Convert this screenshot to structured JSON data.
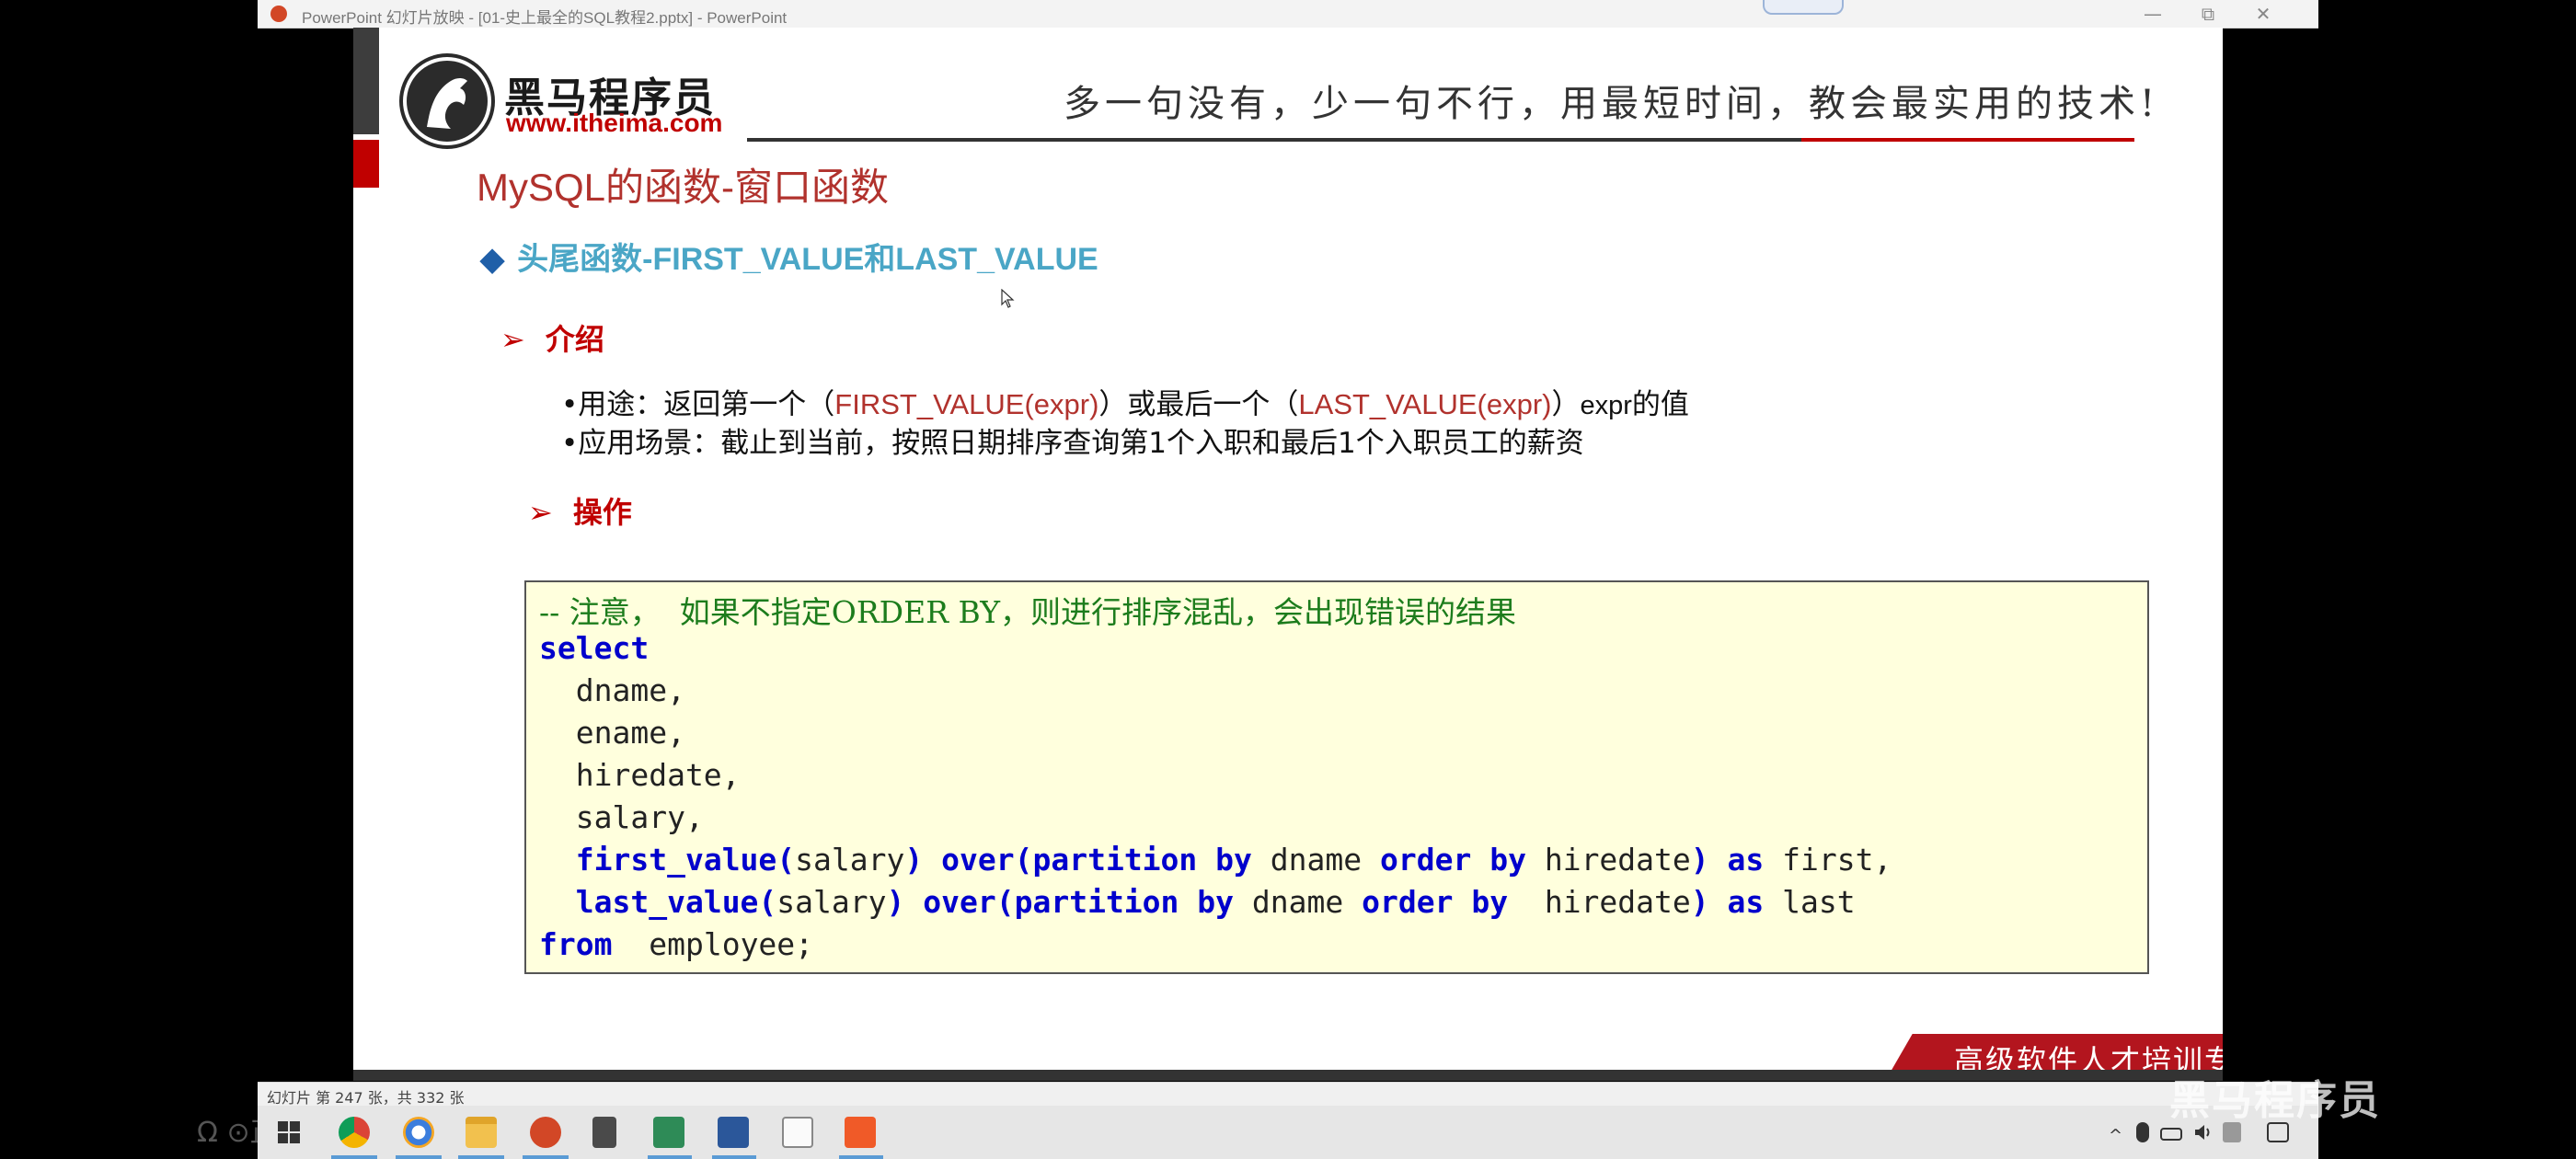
{
  "window": {
    "title": "PowerPoint 幻灯片放映 - [01-史上最全的SQL教程2.pptx] - PowerPoint",
    "controls": {
      "minimize": "—",
      "restore": "⧉",
      "close": "✕"
    }
  },
  "slide": {
    "logo_cn": "黑马程序员",
    "logo_url": "www.itheima.com",
    "slogan": "多一句没有，少一句不行，用最短时间，教会最实用的技术!",
    "title": "MySQL的函数-窗口函数",
    "subtitle": {
      "marker": "◆",
      "cn": "头尾函数",
      "en": "-FIRST_VALUE和LAST_VALUE"
    },
    "intro_label": "介绍",
    "bullet1": {
      "pre": "•用途：返回第一个（",
      "fn1": "FIRST_VALUE(expr)",
      "mid": "）或最后一个（",
      "fn2": "LAST_VALUE(expr)",
      "post1": "）",
      "post2": "expr",
      "post3": "的值"
    },
    "bullet2": "•应用场景：截止到当前，按照日期排序查询第1个入职和最后1个入职员工的薪资",
    "op_label": "操作",
    "code": {
      "comment": "-- 注意，  如果不指定ORDER BY，则进行排序混乱，会出现错误的结果",
      "select": "select",
      "cols": [
        "  dname,",
        "  ename,",
        "  hiredate,",
        "  salary,"
      ],
      "line5": {
        "fn": "first_value(",
        "arg": "salary",
        "close": ")",
        "over": "over(partition by",
        "col": "dname",
        "order": "order by",
        "col2": "hiredate",
        "close2": ")",
        "as": "as",
        "alias": "first,"
      },
      "line6": {
        "fn": "last_value(",
        "arg": "salary",
        "close": ")",
        "over": "over(partition by",
        "col": "dname",
        "order": "order by",
        "col2": " hiredate",
        "close2": ")",
        "as": "as",
        "alias": "last"
      },
      "from": "from",
      "table": " employee;"
    },
    "footer": "高级软件人才培训专家"
  },
  "status": {
    "slide_count": "幻灯片 第 247 张，共 332 张"
  },
  "taskbar": {
    "apps": [
      "start",
      "chrome",
      "browser",
      "file-explorer",
      "powerpoint",
      "calculator",
      "chart-app",
      "word",
      "typora",
      "screen-recorder"
    ],
    "tray": [
      "^",
      "mic",
      "battery",
      "volume",
      "ime",
      "notification"
    ]
  },
  "watermark": "黑马程序员",
  "edge_text": "Ω ⊙正在"
}
